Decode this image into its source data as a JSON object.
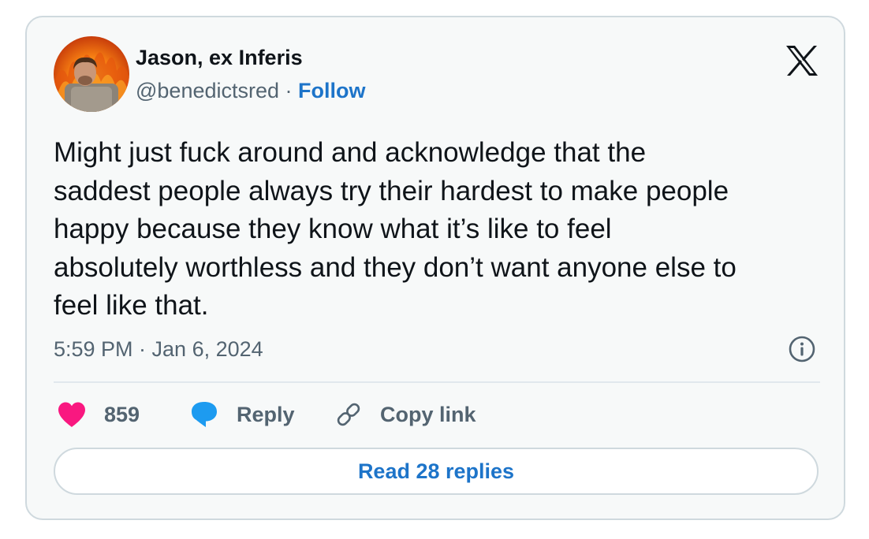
{
  "author": {
    "display_name": "Jason, ex Inferis",
    "handle": "@benedictsred",
    "separator": "·",
    "follow_label": "Follow"
  },
  "tweet": {
    "lines": [
      "Might just fuck around and acknowledge that the",
      "saddest people always try their hardest to make people",
      "happy because they know what it’s like to feel",
      "absolutely worthless and they don’t want anyone else to",
      "feel like that."
    ],
    "timestamp": "5:59 PM · Jan 6, 2024"
  },
  "actions": {
    "like_count": "859",
    "reply_label": "Reply",
    "copy_link_label": "Copy link"
  },
  "read_replies_label": "Read 28 replies",
  "icons": {
    "brand": "x-logo-icon",
    "info": "info-icon",
    "like": "heart-icon",
    "reply": "speech-bubble-icon",
    "copy": "link-icon"
  },
  "colors": {
    "link_blue": "#1d74c9",
    "heart_pink": "#f91880",
    "reply_blue": "#1d9bf0",
    "text_primary": "#0f1419",
    "text_secondary": "#536471",
    "card_background": "#f7f9f9",
    "border": "#cfd9de"
  }
}
